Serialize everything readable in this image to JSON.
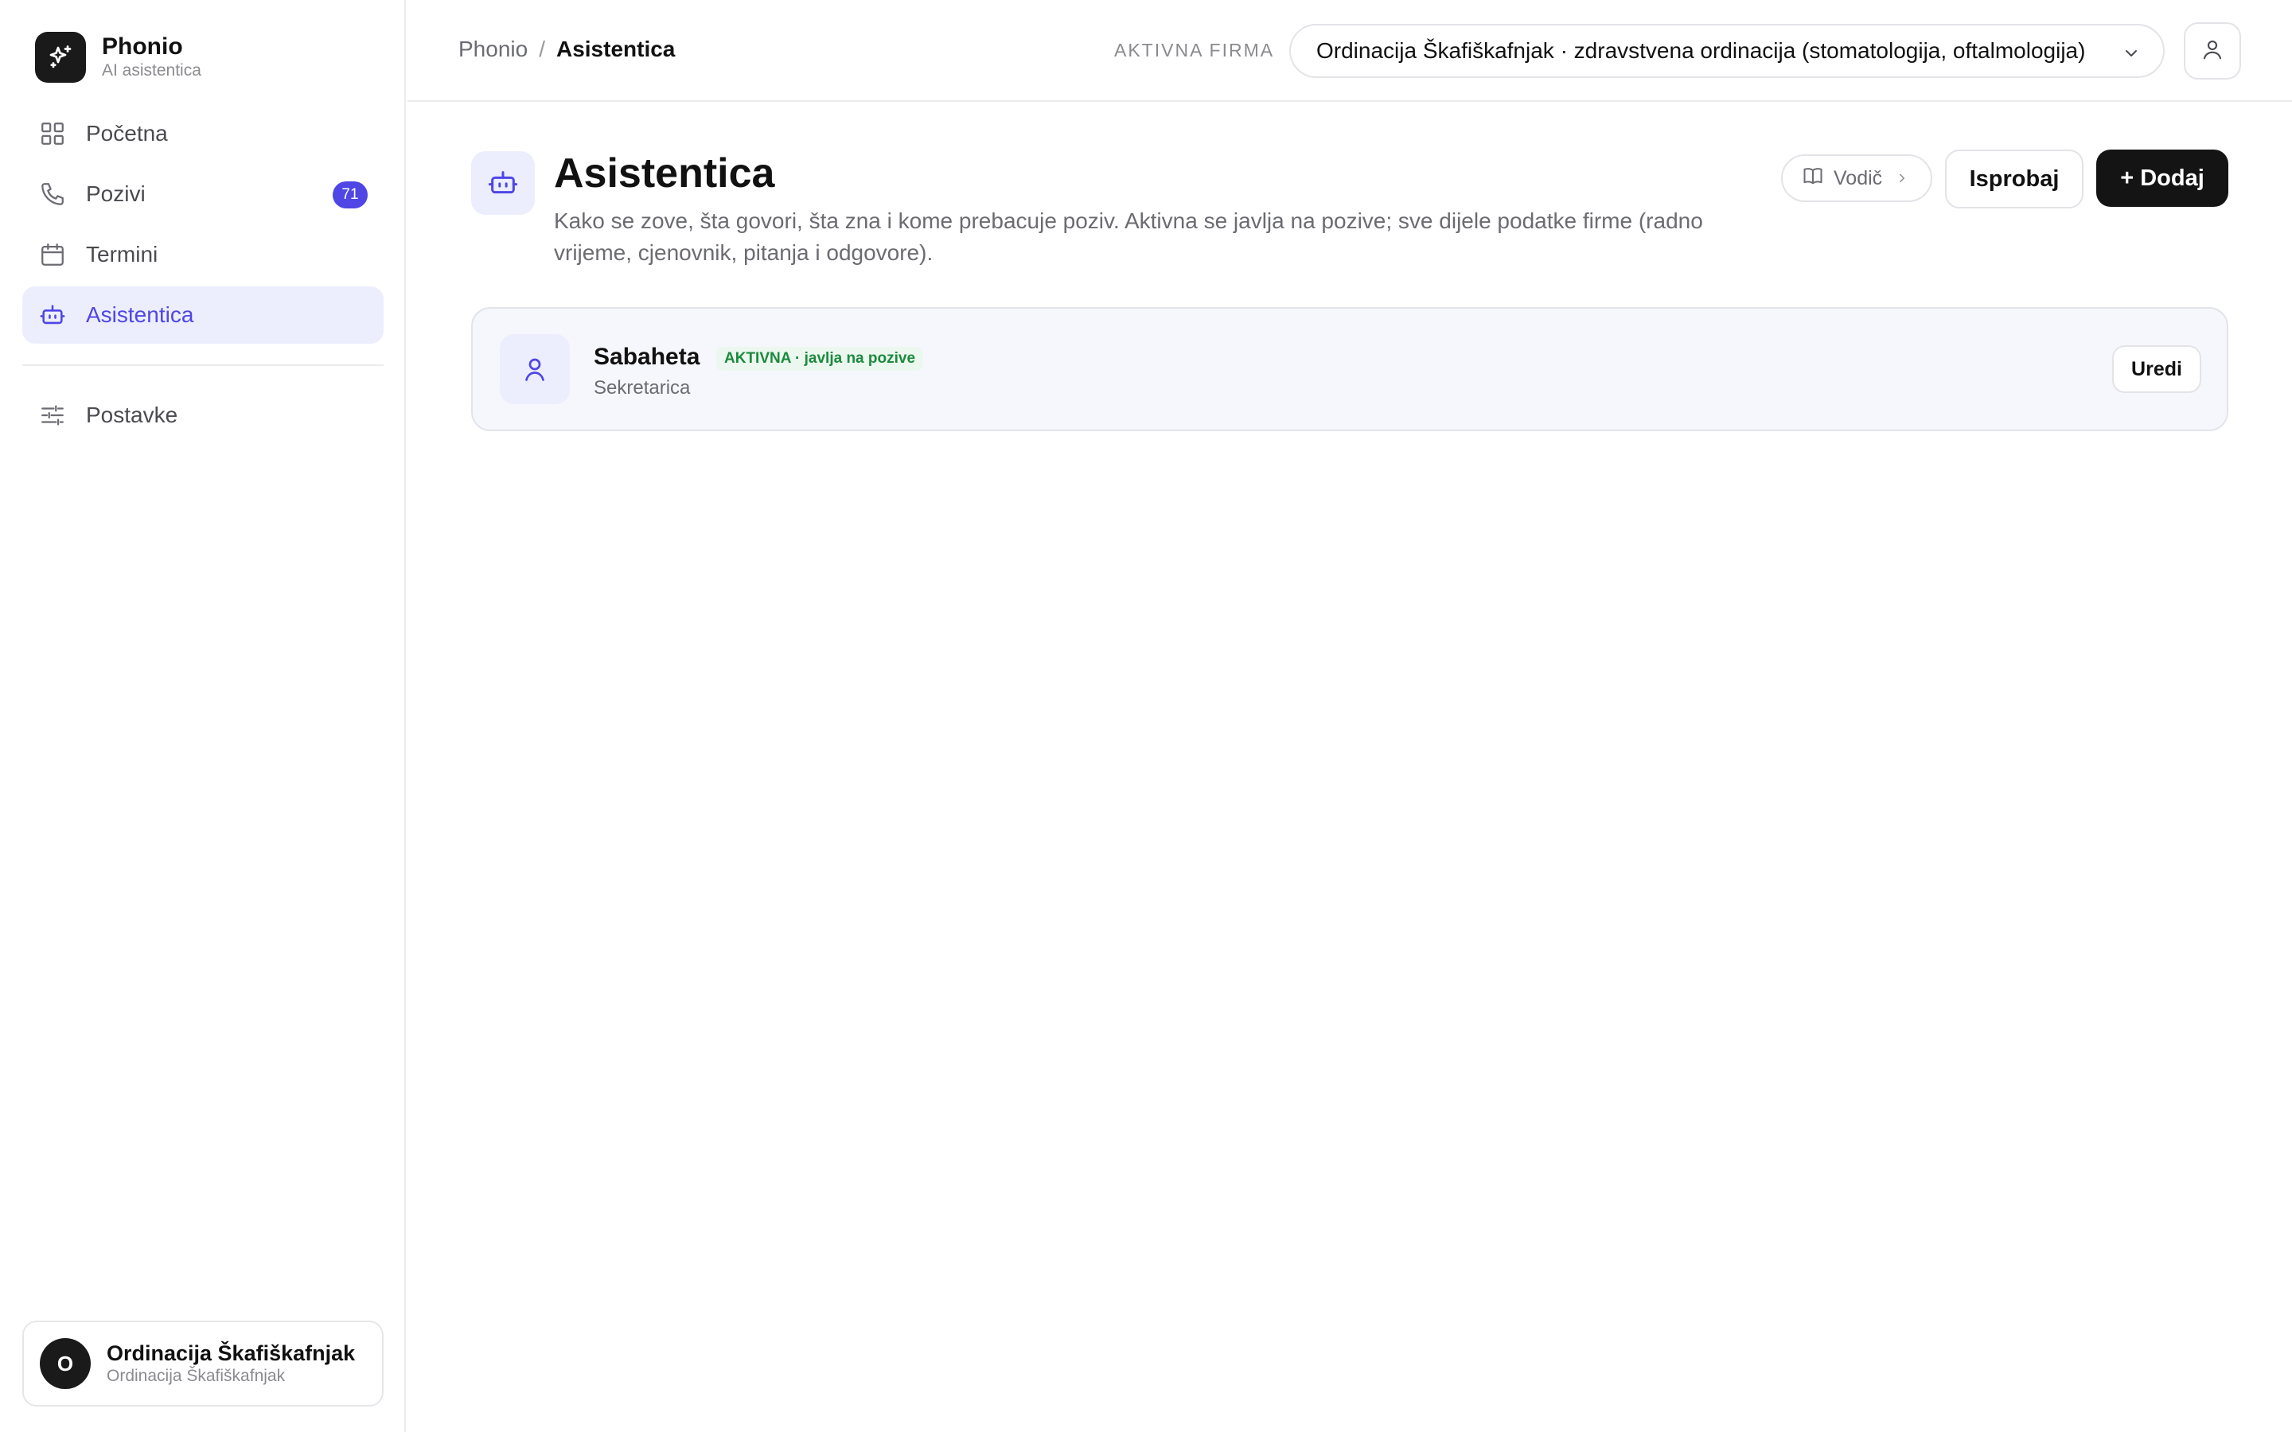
{
  "brand": {
    "name": "Phonio",
    "subtitle": "AI asistentica"
  },
  "sidebar": {
    "items": [
      {
        "label": "Početna",
        "icon": "grid-icon"
      },
      {
        "label": "Pozivi",
        "icon": "phone-icon",
        "badge": "71"
      },
      {
        "label": "Termini",
        "icon": "calendar-icon"
      },
      {
        "label": "Asistentica",
        "icon": "bot-icon",
        "active": true
      },
      {
        "label": "Postavke",
        "icon": "sliders-icon"
      }
    ]
  },
  "account": {
    "initial": "O",
    "name": "Ordinacija Škafiškafnjak",
    "subtitle": "Ordinacija Škafiškafnjak"
  },
  "topbar": {
    "breadcrumb": {
      "root": "Phonio",
      "separator": "/",
      "current": "Asistentica"
    },
    "firm_label": "AKTIVNA FIRMA",
    "firm_value": "Ordinacija Škafiškafnjak · zdravstvena ordinacija (stomatologija, oftalmologija)"
  },
  "page": {
    "title": "Asistentica",
    "description": "Kako se zove, šta govori, šta zna i kome prebacuje poziv. Aktivna se javlja na pozive; sve dijele podatke firme (radno vrijeme, cjenovnik, pitanja i odgovore)."
  },
  "actions": {
    "guide_label": "Vodič",
    "try_label": "Isprobaj",
    "add_label": "+ Dodaj"
  },
  "assistants": [
    {
      "name": "Sabaheta",
      "status": "AKTIVNA · javlja na pozive",
      "role": "Sekretarica",
      "edit_label": "Uredi"
    }
  ],
  "colors": {
    "accent": "#4f46e5",
    "active_bg": "#eceefd",
    "status_green": "#1b8a3e",
    "dark": "#141414"
  }
}
